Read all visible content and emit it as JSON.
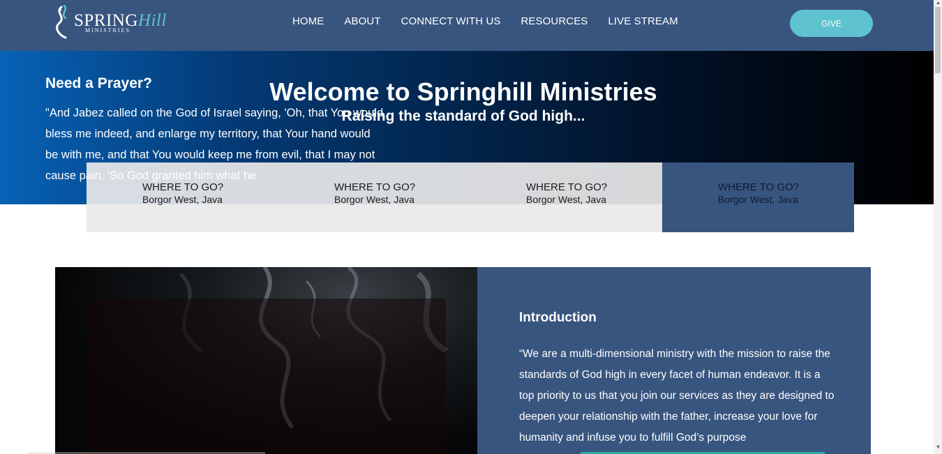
{
  "brand": {
    "logo_word_spring": "SPRING",
    "logo_word_hill": "Hill",
    "logo_sub": "MINISTRIES"
  },
  "nav": {
    "items": [
      "HOME",
      "ABOUT",
      "CONNECT WITH US",
      "RESOURCES",
      "LIVE STREAM"
    ],
    "give_label": "GIVE"
  },
  "hero": {
    "title": "Welcome to Springhill Ministries",
    "subtitle": "Raising the standard of God high..."
  },
  "cards": [
    {
      "title": "WHERE TO GO?",
      "location": "Borgor West, Java"
    },
    {
      "title": "WHERE TO GO?",
      "location": "Borgor West, Java"
    },
    {
      "title": "WHERE TO GO?",
      "location": "Borgor West, Java"
    },
    {
      "title": "WHERE TO GO?",
      "location": "Borgor West, Java"
    }
  ],
  "prayer": {
    "title": "Need a Prayer?",
    "text": "\"And Jabez called on the God of Israel saying, 'Oh, that You would bless me indeed, and enlarge my territory, that Your hand would be with me, and that You would keep me from evil, that I may not cause pain. 'So God granted him what he"
  },
  "intro": {
    "title": "Introduction",
    "text": "“We are a multi-dimensional ministry with the mission to raise the standards of God high in every facet of human endeavor. It is a top priority to us that you join our services as they are designed to deepen your relationship with the father, increase your love for humanity and infuse you to fulfill God’s purpose"
  },
  "colors": {
    "header": "#38557f",
    "accent": "#5fc3cf",
    "card": "#e9e9e9"
  }
}
